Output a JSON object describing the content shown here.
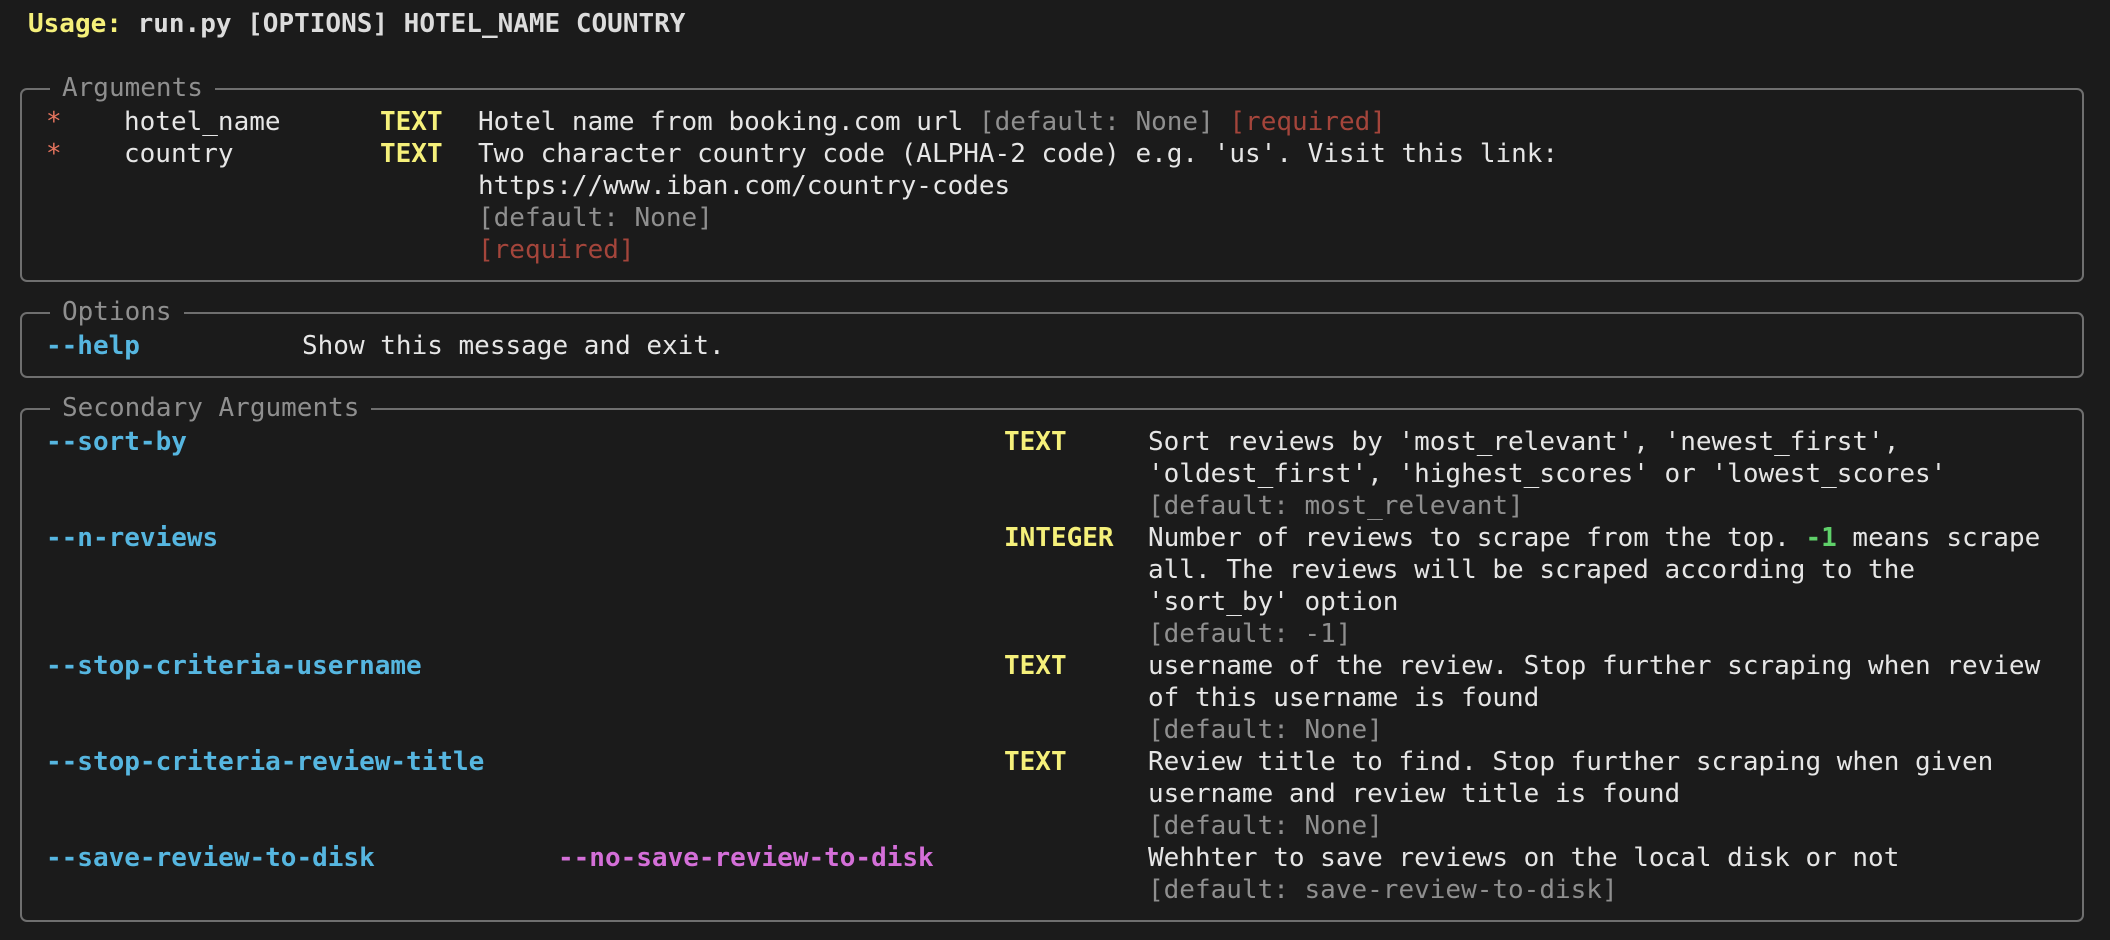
{
  "usage": {
    "label": "Usage:",
    "command": " run.py [OPTIONS] HOTEL_NAME COUNTRY"
  },
  "arguments_panel": {
    "title": "Arguments",
    "rows": [
      {
        "marker": "*",
        "name": "hotel_name",
        "type": "TEXT",
        "description": "Hotel name from booking.com url",
        "default": "[default: None]",
        "required": "[required]"
      },
      {
        "marker": "*",
        "name": "country",
        "type": "TEXT",
        "description_line1": "Two character country code (ALPHA-2 code) e.g. 'us'. Visit this link:",
        "description_line2": "https://www.iban.com/country-codes",
        "default": "[default: None]",
        "required": "[required]"
      }
    ]
  },
  "options_panel": {
    "title": "Options",
    "rows": [
      {
        "option": "--help",
        "description": "Show this message and exit."
      }
    ]
  },
  "secondary_panel": {
    "title": "Secondary Arguments",
    "rows": [
      {
        "option": "--sort-by",
        "type": "TEXT",
        "description_line1": "Sort reviews by 'most_relevant', 'newest_first',",
        "description_line2": "'oldest_first', 'highest_scores' or 'lowest_scores'",
        "default": "[default: most_relevant]"
      },
      {
        "option": "--n-reviews",
        "type": "INTEGER",
        "description_line1_a": "Number of reviews to scrape from the top. ",
        "description_line1_num": "-1",
        "description_line1_b": " means scrape",
        "description_line2": "all. The reviews will be scraped according to the",
        "description_line3": "'sort_by' option",
        "default": "[default: -1]"
      },
      {
        "option": "--stop-criteria-username",
        "type": "TEXT",
        "description_line1": "username of the review. Stop further scraping when review",
        "description_line2": "of this username is found",
        "default": "[default: None]"
      },
      {
        "option": "--stop-criteria-review-title",
        "type": "TEXT",
        "description_line1": "Review title to find. Stop further scraping when given",
        "description_line2": "username and review title is found",
        "default": "[default: None]"
      },
      {
        "option": "--save-review-to-disk",
        "negative_option": "--no-save-review-to-disk",
        "description_line1": "Wehhter to save reviews on the local disk or not",
        "default": "[default: save-review-to-disk]"
      }
    ]
  },
  "colors": {
    "background": "#1b1b1b",
    "usage_label": "#f5f07a",
    "option": "#56b6e0",
    "negative_option": "#d46fd8",
    "type": "#f5f07a",
    "required": "#a4453b",
    "default": "#8f8f8f",
    "number": "#5fd06a"
  }
}
